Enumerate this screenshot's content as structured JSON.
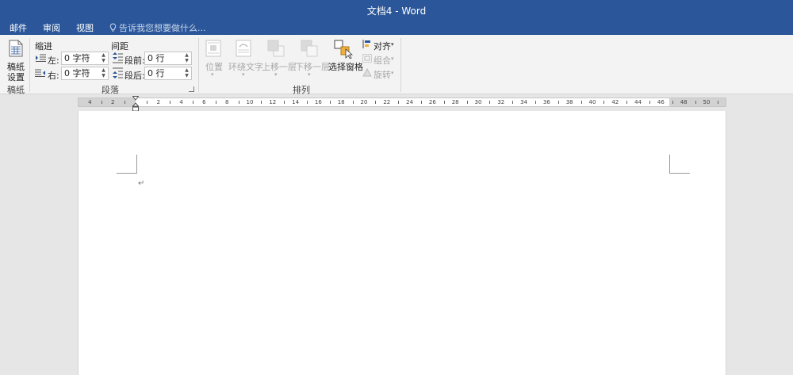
{
  "window": {
    "title": "文档4 - Word"
  },
  "tabs": [
    {
      "label": "邮件"
    },
    {
      "label": "审阅"
    },
    {
      "label": "视图"
    }
  ],
  "tell_me": {
    "placeholder": "告诉我您想要做什么...",
    "icon": "lightbulb-icon"
  },
  "ribbon": {
    "manuscript": {
      "button_label_1": "稿纸",
      "button_label_2": "设置",
      "group_label": "稿纸"
    },
    "paragraph": {
      "indent_header": "缩进",
      "spacing_header": "间距",
      "indent_left_label": "左:",
      "indent_left_value": "0 字符",
      "indent_right_label": "右:",
      "indent_right_value": "0 字符",
      "spacing_before_label": "段前:",
      "spacing_before_value": "0 行",
      "spacing_after_label": "段后:",
      "spacing_after_value": "0 行",
      "group_label": "段落"
    },
    "arrange": {
      "position": "位置",
      "wrap_text": "环绕文字",
      "bring_forward": "上移一层",
      "send_backward": "下移一层",
      "selection_pane": "选择窗格",
      "align": "对齐",
      "group": "组合",
      "rotate": "旋转",
      "group_label": "排列"
    }
  },
  "ruler": {
    "labels": [
      "4",
      "2",
      "2",
      "4",
      "6",
      "8",
      "10",
      "12",
      "14",
      "16",
      "18",
      "20",
      "22",
      "24",
      "26",
      "28",
      "30",
      "32",
      "34",
      "36",
      "38",
      "40",
      "42",
      "44",
      "46",
      "48",
      "50"
    ]
  },
  "document": {
    "paragraph_mark": "↵"
  },
  "colors": {
    "accent": "#2b579a",
    "ribbon_bg": "#f3f3f3",
    "canvas_bg": "#e6e6e6"
  }
}
